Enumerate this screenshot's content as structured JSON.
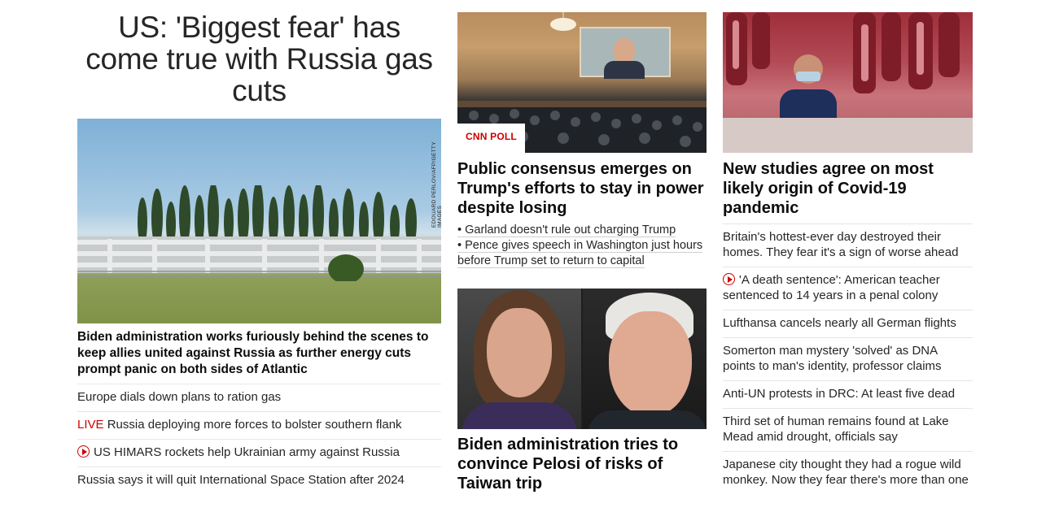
{
  "left": {
    "headline": "US: 'Biggest fear' has come true with Russia gas cuts",
    "image_credit": "EDOUARD PERLOV/AFP/GETTY IMAGES",
    "hero_title": "Biden administration works furiously behind the scenes to keep allies united against Russia as further energy cuts prompt panic on both sides of Atlantic",
    "items": [
      {
        "text": "Europe dials down plans to ration gas"
      },
      {
        "live": "LIVE",
        "text": "Russia deploying more forces to bolster southern flank"
      },
      {
        "icon": "play-icon",
        "text": "US HIMARS rockets help Ukrainian army against Russia"
      },
      {
        "text": "Russia says it will quit International Space Station after 2024"
      }
    ]
  },
  "middle": {
    "story1": {
      "badge": "CNN POLL",
      "title": "Public consensus emerges on Trump's efforts to stay in power despite losing",
      "bullets": [
        "• Garland doesn't rule out charging Trump",
        "• Pence gives speech in Washington just hours before Trump set to return to capital"
      ]
    },
    "story2": {
      "title": "Biden administration tries to convince Pelosi of risks of Taiwan trip"
    }
  },
  "right": {
    "title": "New studies agree on most likely origin of Covid-19 pandemic",
    "items": [
      {
        "text": "Britain's hottest-ever day destroyed their homes. They fear it's a sign of worse ahead"
      },
      {
        "icon": "play-icon",
        "text": "'A death sentence': American teacher sentenced to 14 years in a penal colony"
      },
      {
        "text": "Lufthansa cancels nearly all German flights"
      },
      {
        "text": "Somerton man mystery 'solved' as DNA points to man's identity, professor claims"
      },
      {
        "text": "Anti-UN protests in DRC: At least five dead"
      },
      {
        "text": "Third set of human remains found at Lake Mead amid drought, officials say"
      },
      {
        "text": "Japanese city thought they had a rogue wild monkey. Now they fear there's more than one"
      }
    ]
  },
  "colors": {
    "accent_red": "#cc0000",
    "text": "#0c0c0c",
    "divider": "#e6e6e6"
  }
}
